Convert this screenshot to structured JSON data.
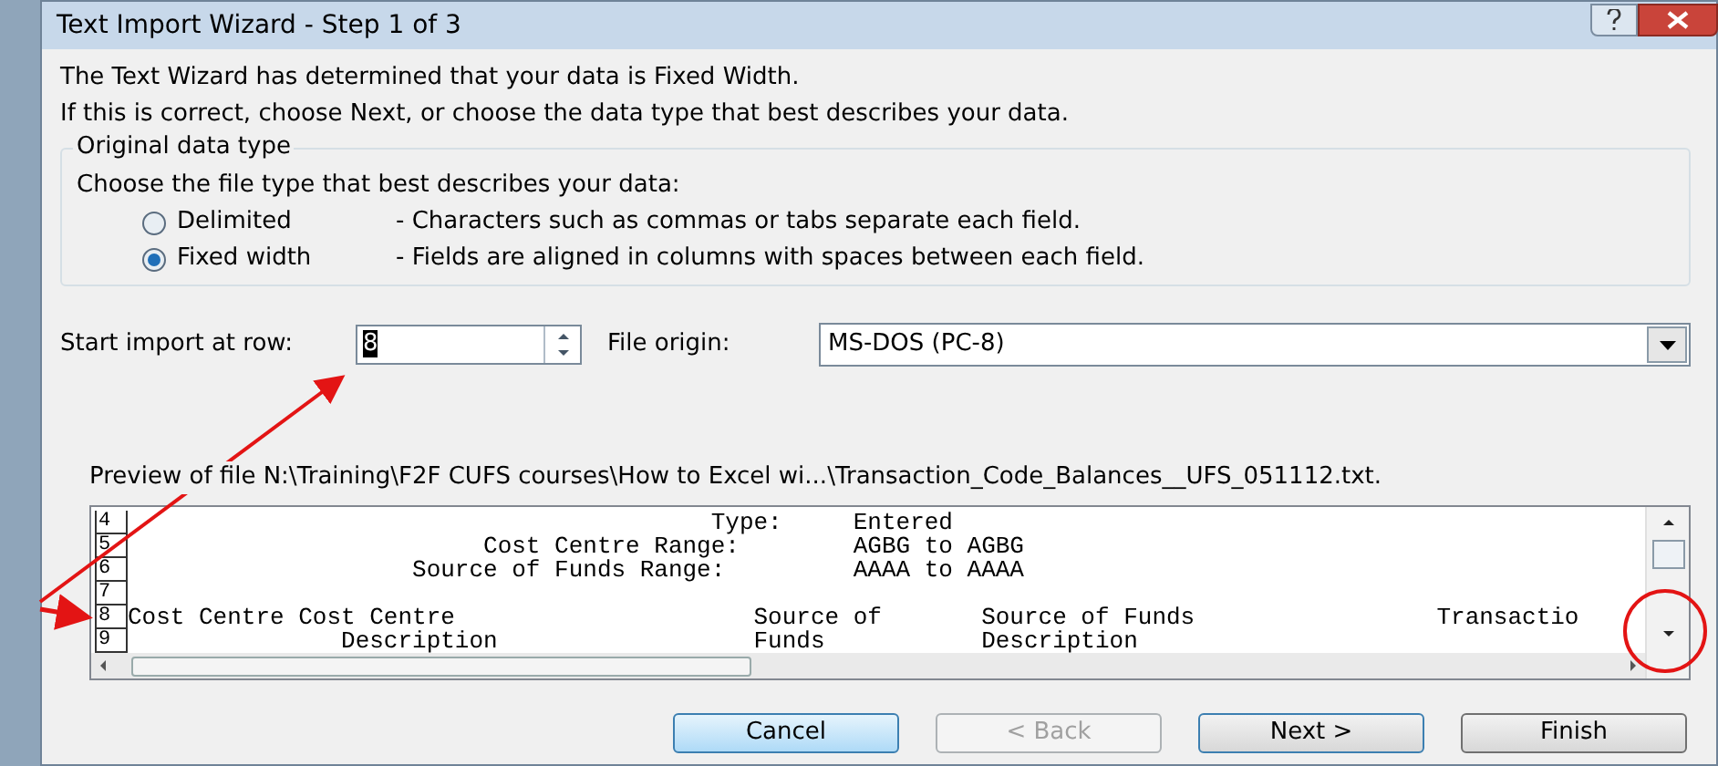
{
  "window": {
    "title": "Text Import Wizard - Step 1 of 3"
  },
  "intro": [
    "The Text Wizard has determined that your data is Fixed Width.",
    "If this is correct, choose Next, or choose the data type that best describes your data."
  ],
  "data_type": {
    "legend": "Original data type",
    "prompt": "Choose the file type that best describes your data:",
    "options": [
      {
        "label": "Delimited",
        "description": "- Characters such as commas or tabs separate each field.",
        "selected": false
      },
      {
        "label": "Fixed width",
        "description": "- Fields are aligned in columns with spaces between each field.",
        "selected": true
      }
    ]
  },
  "start_row": {
    "label": "Start import at row:",
    "value": "8"
  },
  "file_origin": {
    "label": "File origin:",
    "value": "MS-DOS (PC-8)"
  },
  "preview": {
    "label": "Preview of file N:\\Training\\F2F CUFS courses\\How to Excel wi...\\Transaction_Code_Balances__UFS_051112.txt.",
    "rows": [
      {
        "number": "4",
        "text": "                                         Type:     Entered"
      },
      {
        "number": "5",
        "text": "                         Cost Centre Range:        AGBG to AGBG"
      },
      {
        "number": "6",
        "text": "                    Source of Funds Range:         AAAA to AAAA"
      },
      {
        "number": "7"
      },
      {
        "number": "8",
        "text": "Cost Centre Cost Centre                     Source of       Source of Funds                 Transactio"
      },
      {
        "number": "9",
        "text": "               Description                  Funds           Description"
      }
    ]
  },
  "buttons": [
    {
      "label": "Cancel",
      "kind": "focused"
    },
    {
      "label": "< Back",
      "kind": "disabled"
    },
    {
      "label": "Next >",
      "kind": "default"
    },
    {
      "label": "Finish",
      "kind": "normal"
    }
  ]
}
